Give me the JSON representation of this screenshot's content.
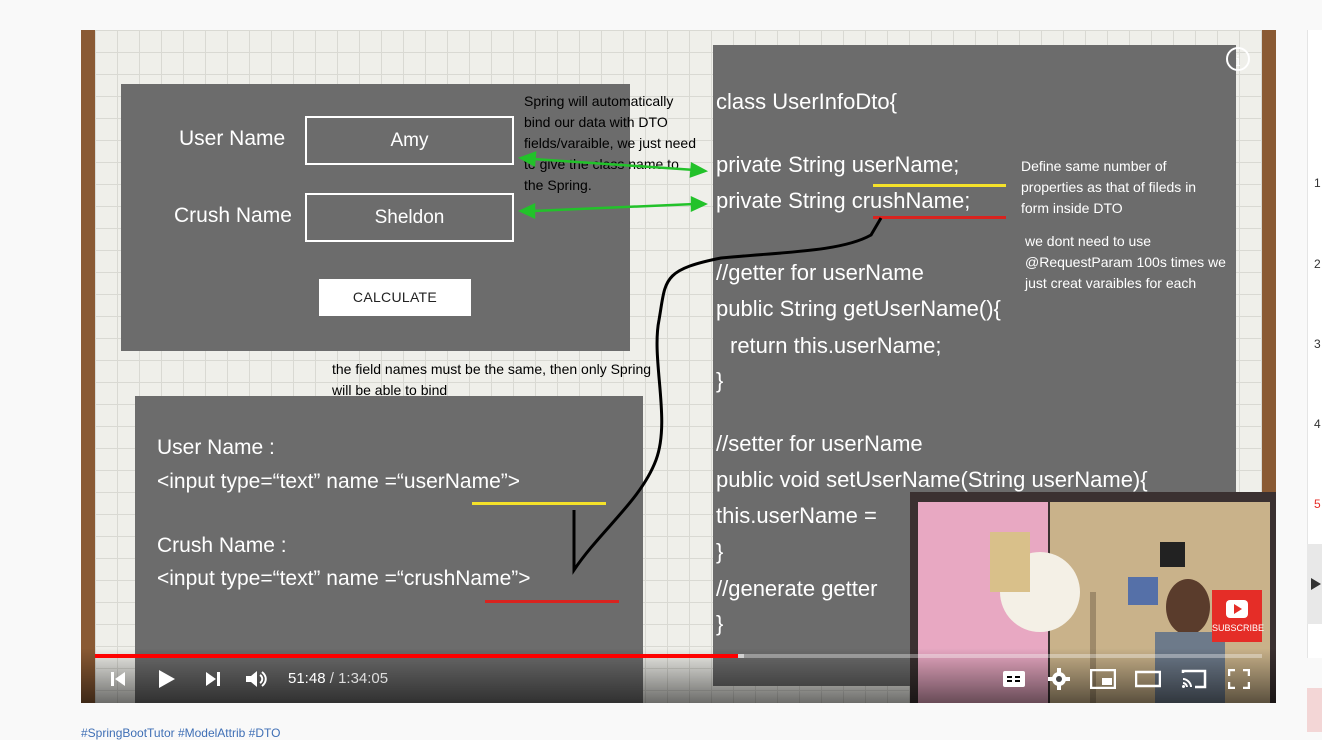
{
  "form_slide": {
    "user_name_label": "User Name",
    "user_name_value": "Amy",
    "crush_name_label": "Crush Name",
    "crush_name_value": "Sheldon",
    "calculate_button": "CALCULATE"
  },
  "html_slide": {
    "line1": "User Name :",
    "line2_prefix": "<input type=“text” name =“",
    "line2_field": "userName",
    "line2_suffix": "”>",
    "line3": "Crush Name :",
    "line4_prefix": "<input type=“text” name =“",
    "line4_field": "crushName",
    "line4_suffix": "”>"
  },
  "code_slide": {
    "class_decl": "class UserInfoDto{",
    "field1_prefix": "private String ",
    "field1_name": "userName;",
    "field2_prefix": "private String ",
    "field2_name": "crushName;",
    "getter_comment": "//getter for userName",
    "getter_sig": "public String getUserName(){",
    "getter_body": "return this.userName;",
    "getter_close": "}",
    "setter_comment": "//setter for userName",
    "setter_sig": "public void setUserName(String userName){",
    "setter_body": "this.userName = ",
    "setter_close": "}",
    "generate_comment": "//generate getter",
    "class_close": "}"
  },
  "annotations": {
    "spring_bind": "Spring will automatically bind our data with DTO fields/varaible, we just need to give the class name to the Spring.",
    "field_names": "the field names must be the same, then only Spring will be able to bind",
    "define_props": "Define same number of properties as that of fileds in form inside DTO",
    "no_request_param": "we dont need to use @RequestParam 100s times we just creat varaibles for each"
  },
  "player": {
    "info_icon": "i",
    "current_time": "51:48",
    "separator": " / ",
    "duration": "1:34:05",
    "progress_fraction": 0.551,
    "buffered_fraction": 0.556,
    "subscribe_label": "SUBSCRIBE"
  },
  "sidebar": {
    "numbers": [
      "1",
      "2",
      "3",
      "4",
      "5"
    ]
  },
  "description": {
    "hashtags": "#SpringBootTutor  #ModelAttrib  #DTO"
  },
  "colors": {
    "panel": "#6c6c6c",
    "progress": "#ff0000",
    "yellow_underline": "#f5e22a",
    "red_underline": "#d9231f",
    "arrow": "#22c22a",
    "subscribe": "#e52d27"
  }
}
